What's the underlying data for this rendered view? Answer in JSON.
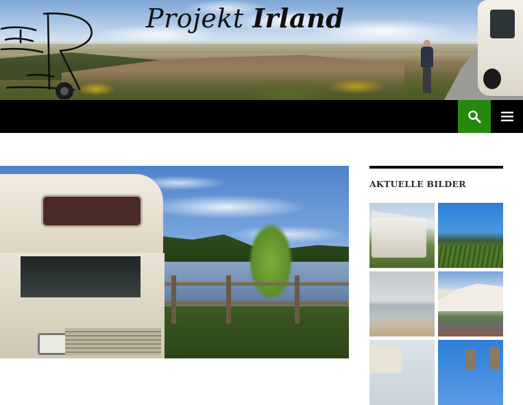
{
  "header": {
    "title_regular": "Projekt ",
    "title_bold": "Irland"
  },
  "nav": {
    "search_icon": "search-icon",
    "menu_icon": "hamburger-menu-icon",
    "accent_color": "#24890d"
  },
  "sidebar": {
    "widget_title": "AKTUELLE BILDER"
  }
}
